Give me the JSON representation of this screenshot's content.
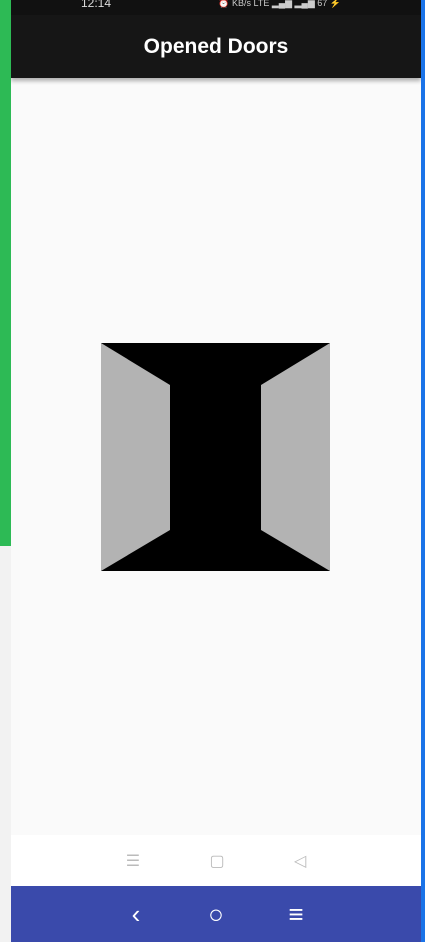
{
  "status_bar": {
    "time": "12:14",
    "icons": "⏰ KB/s LTE ▂▄▆ ▂▄▆ 67 ⚡"
  },
  "app_bar": {
    "title": "Opened Doors"
  },
  "door_image": {
    "background": "#000000",
    "door_color": "#b3b3b3"
  },
  "system_nav": {
    "recents": "☰",
    "home": "▢",
    "back": "◁"
  },
  "host_nav": {
    "back": "‹",
    "home": "○",
    "menu": "≡",
    "color": "#3a4aab"
  }
}
